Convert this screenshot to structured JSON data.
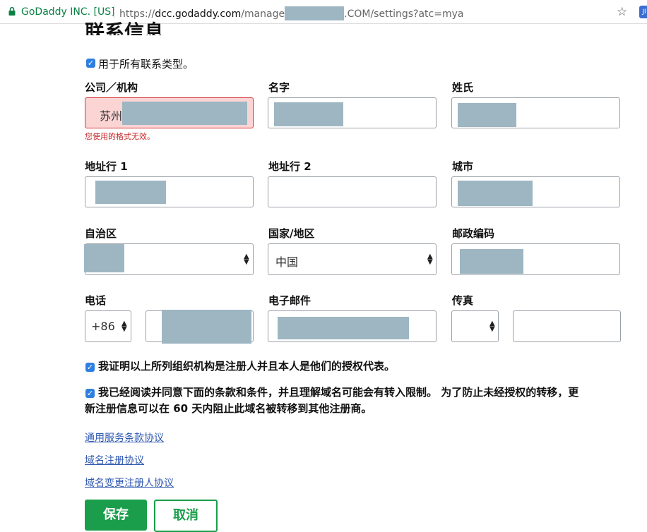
{
  "browser": {
    "secure_label": "GoDaddy INC. [US]",
    "url_prefix": "https://",
    "url_host": "dcc.godaddy.com",
    "url_path": "/manage",
    "url_suffix": ".COM/settings?atc=mya"
  },
  "form": {
    "heading": "联系信息",
    "use_all_label": "用于所有联系类型。",
    "labels": {
      "company": "公司／机构",
      "first_name": "名字",
      "last_name": "姓氏",
      "address1": "地址行 1",
      "address2": "地址行 2",
      "city": "城市",
      "state": "自治区",
      "country": "国家/地区",
      "postal": "邮政编码",
      "phone": "电话",
      "email": "电子邮件",
      "fax": "传真"
    },
    "values": {
      "company_prefix": "苏州",
      "country": "中国",
      "phone_code": "+86"
    },
    "company_error": "您使用的格式无效。",
    "certify_text": "我证明以上所列组织机构是注册人并且本人是他们的授权代表。",
    "agree_line1": "我已经阅读并同意下面的条款和条件，并且理解域名可能会有转入限制。 为了防止未经授权的转移，更",
    "agree_line2": "新注册信息可以在 60 天内阻止此域名被转移到其他注册商。",
    "links": [
      "通用服务条款协议",
      "域名注册协议",
      "域名变更注册人协议"
    ],
    "save_label": "保存",
    "cancel_label": "取消"
  },
  "colors": {
    "accent": "#1b9e4b",
    "link": "#2f58b0",
    "error": "#c62828",
    "secure": "#0b8043"
  }
}
